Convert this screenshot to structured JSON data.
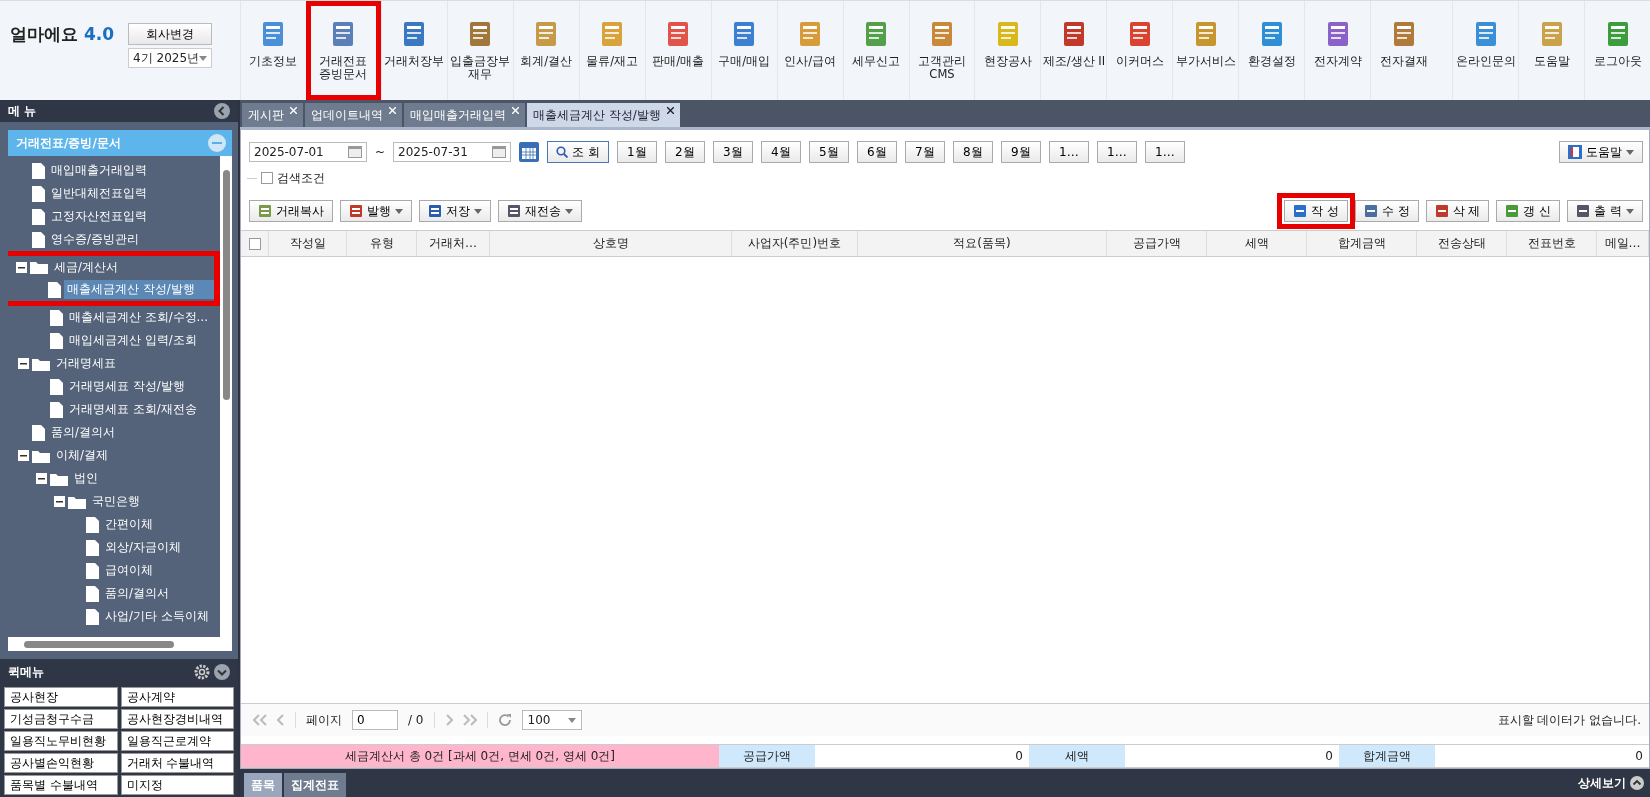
{
  "header": {
    "logo": "얼마에요",
    "version": "4.0",
    "company_button": "회사변경",
    "period": "4기 2025년"
  },
  "toolbar": [
    {
      "lines": [
        "기초정보"
      ],
      "highlighted": false
    },
    {
      "lines": [
        "거래전표",
        "증빙문서"
      ],
      "highlighted": true
    },
    {
      "lines": [
        "거래처장부"
      ],
      "highlighted": false
    },
    {
      "lines": [
        "입출금장부",
        "재무"
      ],
      "highlighted": false
    },
    {
      "lines": [
        "회계/결산"
      ],
      "highlighted": false
    },
    {
      "lines": [
        "물류/재고"
      ],
      "highlighted": false
    },
    {
      "lines": [
        "판매/매출"
      ],
      "highlighted": false
    },
    {
      "lines": [
        "구매/매입"
      ],
      "highlighted": false
    },
    {
      "lines": [
        "인사/급여"
      ],
      "highlighted": false
    },
    {
      "lines": [
        "세무신고"
      ],
      "highlighted": false
    },
    {
      "lines": [
        "고객관리",
        "CMS"
      ],
      "highlighted": false
    },
    {
      "lines": [
        "현장공사"
      ],
      "highlighted": false
    },
    {
      "lines": [
        "제조/생산 II"
      ],
      "highlighted": false
    },
    {
      "lines": [
        "이커머스"
      ],
      "highlighted": false
    },
    {
      "lines": [
        "부가서비스"
      ],
      "highlighted": false
    },
    {
      "lines": [
        "환경설정"
      ],
      "highlighted": false
    },
    {
      "lines": [
        "전자계약"
      ],
      "highlighted": false
    },
    {
      "lines": [
        "전자결재"
      ],
      "highlighted": false
    },
    {
      "lines": [
        "온라인문의"
      ],
      "highlighted": false
    },
    {
      "lines": [
        "도움말"
      ],
      "highlighted": false
    },
    {
      "lines": [
        "로그아웃"
      ],
      "highlighted": false
    }
  ],
  "sidebar": {
    "title": "메 뉴",
    "section": {
      "title": "거래전표/증빙/문서",
      "expanded": true
    },
    "tree": [
      {
        "label": "매입매출거래입력",
        "kind": "file",
        "selected": false,
        "highlighted": false
      },
      {
        "label": "일반대체전표입력",
        "kind": "file",
        "selected": false,
        "highlighted": false
      },
      {
        "label": "고정자산전표입력",
        "kind": "file",
        "selected": false,
        "highlighted": false
      },
      {
        "label": "영수증/증빙관리",
        "kind": "file",
        "selected": false,
        "highlighted": false
      },
      {
        "label": "세금/계산서",
        "kind": "folder",
        "expanded": true,
        "selected": false,
        "highlighted": true,
        "children": [
          {
            "label": "매출세금계산 작성/발행",
            "kind": "file",
            "selected": true,
            "highlighted": true
          },
          {
            "label": "매출세금계산 조회/수정…",
            "kind": "file",
            "selected": false,
            "highlighted": false
          },
          {
            "label": "매입세금계산 입력/조회",
            "kind": "file",
            "selected": false,
            "highlighted": false
          }
        ]
      },
      {
        "label": "거래명세표",
        "kind": "folder",
        "expanded": true,
        "selected": false,
        "highlighted": false,
        "children": [
          {
            "label": "거래명세표 작성/발행",
            "kind": "file",
            "selected": false,
            "highlighted": false
          },
          {
            "label": "거래명세표 조회/재전송",
            "kind": "file",
            "selected": false,
            "highlighted": false
          }
        ]
      },
      {
        "label": "품의/결의서",
        "kind": "file",
        "selected": false,
        "highlighted": false
      },
      {
        "label": "이체/결제",
        "kind": "folder",
        "expanded": true,
        "selected": false,
        "highlighted": false,
        "children": [
          {
            "label": "법인",
            "kind": "folder",
            "expanded": true,
            "selected": false,
            "highlighted": false,
            "children": [
              {
                "label": "국민은행",
                "kind": "folder",
                "expanded": true,
                "selected": false,
                "highlighted": false,
                "children": [
                  {
                    "label": "간편이체",
                    "kind": "file",
                    "selected": false,
                    "highlighted": false
                  },
                  {
                    "label": "외상/자금이체",
                    "kind": "file",
                    "selected": false,
                    "highlighted": false
                  },
                  {
                    "label": "급여이체",
                    "kind": "file",
                    "selected": false,
                    "highlighted": false
                  },
                  {
                    "label": "품의/결의서",
                    "kind": "file",
                    "selected": false,
                    "highlighted": false
                  },
                  {
                    "label": "사업/기타 소득이체",
                    "kind": "file",
                    "selected": false,
                    "highlighted": false
                  }
                ]
              }
            ]
          }
        ]
      }
    ],
    "quick_menu": {
      "title": "퀵메뉴",
      "items": [
        "공사현장",
        "공사계약",
        "기성금청구수금",
        "공사현장경비내역",
        "일용직노무비현황",
        "일용직근로계약",
        "공사별손익현황",
        "거래처 수불내역",
        "품목별 수불내역",
        "미지정"
      ]
    }
  },
  "tabs": [
    {
      "label": "게시판",
      "selected": false
    },
    {
      "label": "업데이트내역",
      "selected": false
    },
    {
      "label": "매입매출거래입력",
      "selected": false
    },
    {
      "label": "매출세금계산 작성/발행",
      "selected": true
    }
  ],
  "filter": {
    "date_from": "2025-07-01",
    "separator": "~",
    "date_to": "2025-07-31",
    "search_button": "조 회",
    "months": [
      "1월",
      "2월",
      "3월",
      "4월",
      "5월",
      "6월",
      "7월",
      "8월",
      "9월",
      "1…",
      "1…",
      "1…"
    ],
    "help_button": "도움말",
    "condition": {
      "label": "검색조건",
      "checked": false
    }
  },
  "actions_left": [
    {
      "label": "거래복사",
      "dropdown": false
    },
    {
      "label": "발행",
      "dropdown": true
    },
    {
      "label": "저장",
      "dropdown": true
    },
    {
      "label": "재전송",
      "dropdown": true
    }
  ],
  "actions_right": [
    {
      "label": "작 성",
      "dropdown": false,
      "highlighted": true
    },
    {
      "label": "수 정",
      "dropdown": false,
      "highlighted": false
    },
    {
      "label": "삭 제",
      "dropdown": false,
      "highlighted": false
    },
    {
      "label": "갱 신",
      "dropdown": false,
      "highlighted": false
    },
    {
      "label": "출 력",
      "dropdown": true,
      "highlighted": false
    }
  ],
  "table": {
    "select_all_checked": false,
    "columns": [
      "작성일",
      "유형",
      "거래처…",
      "상호명",
      "사업자(주민)번호",
      "적요(품목)",
      "공급가액",
      "세액",
      "합계금액",
      "전송상태",
      "전표번호",
      "메일…"
    ]
  },
  "pager": {
    "page_label": "페이지",
    "page": "0",
    "total": "/ 0",
    "page_size": "100",
    "empty_message": "표시할 데이터가 없습니다."
  },
  "summary": {
    "caption": "세금계산서 총 0건 [과세 0건, 면세 0건, 영세 0건]",
    "fields": [
      {
        "label": "공급가액",
        "value": "0"
      },
      {
        "label": "세액",
        "value": "0"
      },
      {
        "label": "합계금액",
        "value": "0"
      }
    ]
  },
  "bottom_tabs": [
    {
      "label": "품목",
      "selected": true
    },
    {
      "label": "집계전표",
      "selected": false
    }
  ],
  "detail_toggle": "상세보기"
}
